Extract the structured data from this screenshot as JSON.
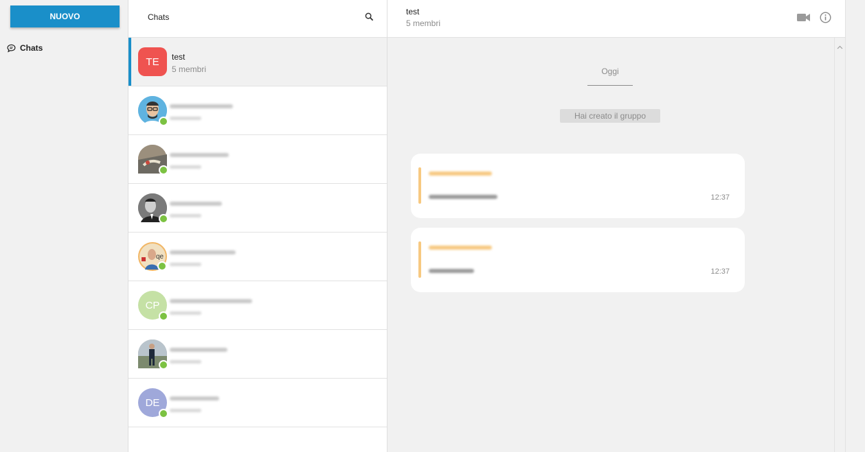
{
  "nav": {
    "new_button": "NUOVO",
    "items": [
      {
        "label": "Chats",
        "icon": "chat-bubble-icon"
      }
    ]
  },
  "chat_list": {
    "title": "Chats",
    "search_icon": "search-icon",
    "items": [
      {
        "initials": "TE",
        "name": "test",
        "subtitle": "5 membri",
        "avatar_color": "#ef5350",
        "active": true
      },
      {
        "initials": "",
        "avatar_color": "#5fb3e0",
        "online": true
      },
      {
        "initials": "",
        "avatar_color": "#8a7f70",
        "online": true
      },
      {
        "initials": "",
        "avatar_color": "#555555",
        "online": true
      },
      {
        "initials": "",
        "avatar_color": "#e8c48a",
        "online": true
      },
      {
        "initials": "CP",
        "avatar_color": "#c5e1a5",
        "online": true
      },
      {
        "initials": "",
        "avatar_color": "#8d8d8d",
        "online": true
      },
      {
        "initials": "DE",
        "avatar_color": "#9fa8da",
        "online": true
      }
    ]
  },
  "conversation": {
    "title": "test",
    "subtitle": "5 membri",
    "date_separator": "Oggi",
    "system_message": "Hai creato il gruppo",
    "messages": [
      {
        "time": "12:37"
      },
      {
        "time": "12:37"
      }
    ]
  },
  "colors": {
    "accent": "#1a8fc9",
    "online": "#7cc242",
    "quote_bar": "#f7c981"
  }
}
